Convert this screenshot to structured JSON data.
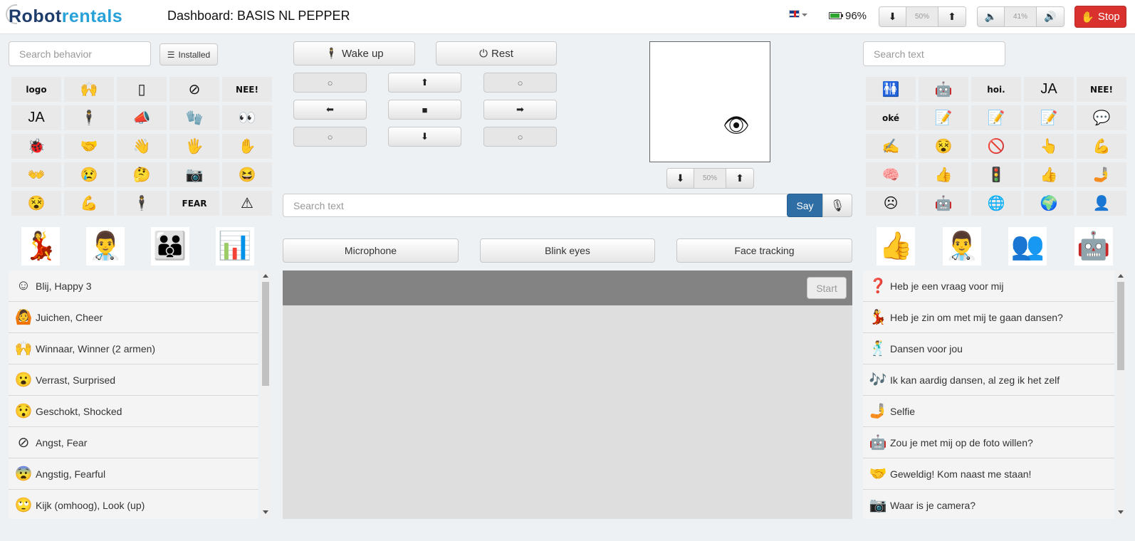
{
  "header": {
    "logo_part1": "Robot",
    "logo_part2": "rentals",
    "title": "Dashboard: BASIS NL PEPPER",
    "battery_text": "96%",
    "battery_level": 0.96,
    "motion_value": "50%",
    "volume_value": "41%",
    "stop_label": "Stop"
  },
  "left": {
    "search_placeholder": "Search behavior",
    "installed_label": "Installed",
    "tiles": [
      {
        "text": "logo",
        "icon": "logo-icon"
      },
      {
        "text": "🙌",
        "icon": "person-arms-up-icon"
      },
      {
        "text": "▯",
        "icon": "tablet-icon"
      },
      {
        "text": "⊘",
        "icon": "prohibited-icon"
      },
      {
        "text": "NEE!",
        "icon": "nee-icon"
      },
      {
        "text": "JA",
        "icon": "ja-icon"
      },
      {
        "text": "🕴",
        "icon": "person-icon"
      },
      {
        "text": "📣",
        "icon": "whistle-icon"
      },
      {
        "text": "🧤",
        "icon": "gloves-icon"
      },
      {
        "text": "👀",
        "icon": "eyes-icon"
      },
      {
        "text": "🐞",
        "icon": "bug-icon"
      },
      {
        "text": "🤝",
        "icon": "handshake-icon"
      },
      {
        "text": "👋",
        "icon": "wave-hand-icon"
      },
      {
        "text": "🖐",
        "icon": "hand-icon"
      },
      {
        "text": "✋",
        "icon": "palm-icon"
      },
      {
        "text": "👐",
        "icon": "clap-hands-icon"
      },
      {
        "text": "😢",
        "icon": "crying-face-icon"
      },
      {
        "text": "🤔",
        "icon": "thinking-face-icon"
      },
      {
        "text": "📷",
        "icon": "camera-icon"
      },
      {
        "text": "😆",
        "icon": "laughing-face-icon"
      },
      {
        "text": "😵",
        "icon": "dizzy-face-icon"
      },
      {
        "text": "💪",
        "icon": "arm-icon"
      },
      {
        "text": "🕴",
        "icon": "figure-icon"
      },
      {
        "text": "FEAR",
        "icon": "sign-icon"
      },
      {
        "text": "⚠",
        "icon": "warning-icon"
      }
    ],
    "big_icons": [
      {
        "text": "💃",
        "icon": "dance-couple-icon"
      },
      {
        "text": "👨‍⚕️",
        "icon": "doctor-icon"
      },
      {
        "text": "👪",
        "icon": "family-icon"
      },
      {
        "text": "📊",
        "icon": "presentation-icon"
      }
    ],
    "list": [
      {
        "label": "Blij, Happy 3",
        "icon": "☺"
      },
      {
        "label": "Juichen, Cheer",
        "icon": "🙆"
      },
      {
        "label": "Winnaar, Winner (2 armen)",
        "icon": "🙌"
      },
      {
        "label": "Verrast, Surprised",
        "icon": "😮"
      },
      {
        "label": "Geschokt, Shocked",
        "icon": "😯"
      },
      {
        "label": "Angst, Fear",
        "icon": "⊘"
      },
      {
        "label": "Angstig, Fearful",
        "icon": "😨"
      },
      {
        "label": "Kijk (omhoog), Look (up)",
        "icon": "🙄"
      }
    ]
  },
  "center": {
    "wakeup_label": "Wake up",
    "rest_label": "Rest",
    "camera_value": "50%",
    "say_placeholder": "Search text",
    "say_label": "Say",
    "microphone_label": "Microphone",
    "blink_label": "Blink eyes",
    "face_label": "Face tracking",
    "start_label": "Start",
    "direction_symbols": {
      "circle": "○",
      "up": "⬆",
      "down": "⬇",
      "left": "⬅",
      "right": "➡",
      "stop": "■"
    }
  },
  "right": {
    "search_placeholder": "Search text",
    "tiles": [
      {
        "text": "🚻",
        "icon": "people-icon"
      },
      {
        "text": "🤖",
        "icon": "robot-icon"
      },
      {
        "text": "hoi.",
        "icon": "hoi-icon"
      },
      {
        "text": "JA",
        "icon": "ja-icon"
      },
      {
        "text": "NEE!",
        "icon": "nee-icon"
      },
      {
        "text": "oké",
        "icon": "oke-icon"
      },
      {
        "text": "📝",
        "icon": "handwriting-icon"
      },
      {
        "text": "📝",
        "icon": "handwriting-red-icon"
      },
      {
        "text": "📝",
        "icon": "handwriting-small-icon"
      },
      {
        "text": "💬",
        "icon": "speech-bubble-icon"
      },
      {
        "text": "✍",
        "icon": "signature-icon"
      },
      {
        "text": "😵",
        "icon": "face-icon"
      },
      {
        "text": "🚫",
        "icon": "no-entry-icon"
      },
      {
        "text": "👆",
        "icon": "pointing-hand-icon"
      },
      {
        "text": "💪",
        "icon": "arm-icon"
      },
      {
        "text": "🧠",
        "icon": "head-icon"
      },
      {
        "text": "👍",
        "icon": "thumbs-up-outline-icon"
      },
      {
        "text": "🚦",
        "icon": "traffic-light-icon"
      },
      {
        "text": "👍",
        "icon": "like-icon"
      },
      {
        "text": "🤳",
        "icon": "selfie-icon"
      },
      {
        "text": "☹",
        "icon": "sad-face-icon"
      },
      {
        "text": "🤖",
        "icon": "robot-small-icon"
      },
      {
        "text": "🌐",
        "icon": "globe-icon"
      },
      {
        "text": "🌍",
        "icon": "world-icon"
      },
      {
        "text": "👤",
        "icon": "silhouette-icon"
      }
    ],
    "big_icons": [
      {
        "text": "👍",
        "icon": "thumbs-up-icon"
      },
      {
        "text": "👨‍⚕️",
        "icon": "doctor-icon"
      },
      {
        "text": "👥",
        "icon": "heads-icon"
      },
      {
        "text": "🤖",
        "icon": "robot-icon"
      }
    ],
    "list": [
      {
        "label": "Heb je een vraag voor mij",
        "icon": "❓"
      },
      {
        "label": "Heb je zin om met mij te gaan dansen?",
        "icon": "💃"
      },
      {
        "label": "Dansen voor jou",
        "icon": "🕺"
      },
      {
        "label": "Ik kan aardig dansen, al zeg ik het zelf",
        "icon": "🎶"
      },
      {
        "label": "Selfie",
        "icon": "🤳"
      },
      {
        "label": "Zou je met mij op de foto willen?",
        "icon": "🤖"
      },
      {
        "label": "Geweldig! Kom naast me staan!",
        "icon": "🤝"
      },
      {
        "label": "Waar is je camera?",
        "icon": "📷"
      }
    ]
  },
  "colors": {
    "stop": "#d9322e",
    "say": "#2e6ea5",
    "battery": "#2ea32e",
    "logo_dark": "#1f3d6b",
    "logo_light": "#28a0d8"
  }
}
